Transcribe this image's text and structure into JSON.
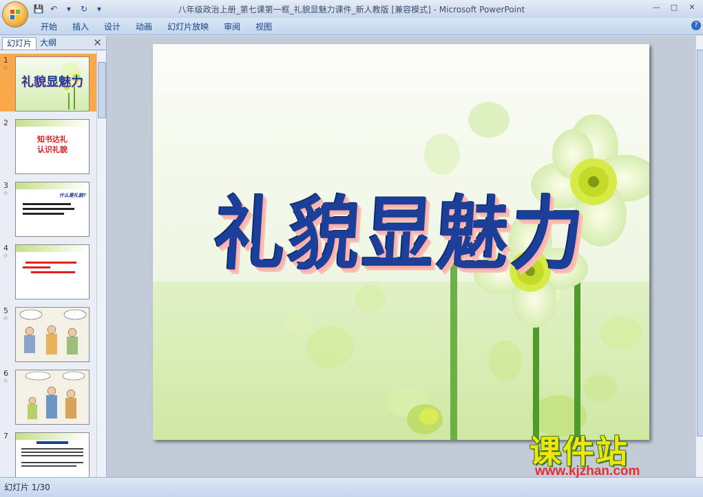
{
  "window": {
    "title": "八年级政治上册_第七课第一框_礼貌显魅力课件_新人教版 [兼容模式] - Microsoft PowerPoint"
  },
  "ribbon": {
    "tabs": [
      "开始",
      "插入",
      "设计",
      "动画",
      "幻灯片放映",
      "审阅",
      "视图"
    ]
  },
  "panel": {
    "tab_slides": "幻灯片",
    "tab_outline": "大纲",
    "thumbnails": [
      {
        "num": "1",
        "title": "礼貌显魅力"
      },
      {
        "num": "2",
        "line1": "知书达礼",
        "line2": "认识礼貌"
      },
      {
        "num": "3",
        "heading": "什么是礼貌?"
      },
      {
        "num": "4"
      },
      {
        "num": "5"
      },
      {
        "num": "6"
      },
      {
        "num": "7"
      }
    ]
  },
  "slide": {
    "title": "礼貌显魅力"
  },
  "status": {
    "slide_counter": "幻灯片 1/30"
  },
  "watermark": {
    "brand": "课件站",
    "url": "www.kjzhan.com"
  }
}
